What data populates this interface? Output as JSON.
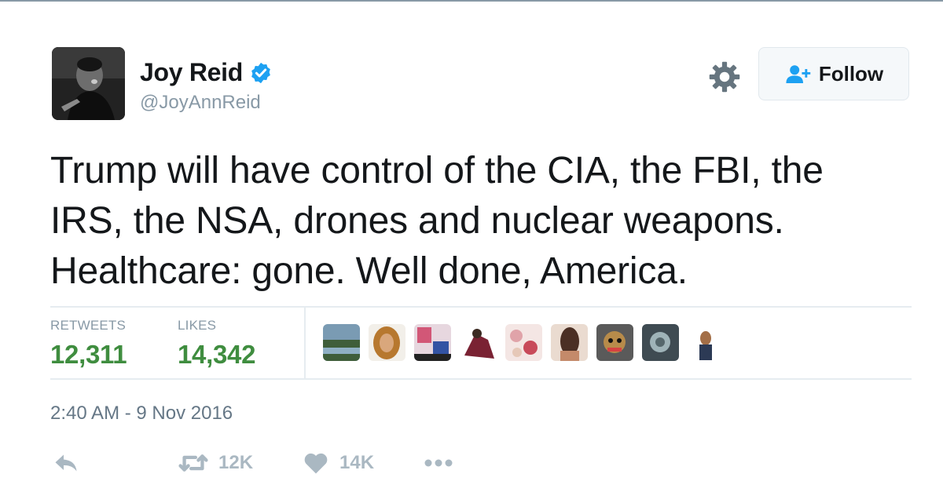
{
  "user": {
    "display_name": "Joy Reid",
    "handle": "@JoyAnnReid",
    "verified": true
  },
  "follow_button": {
    "label": "Follow"
  },
  "tweet": {
    "lines": [
      "Trump will have control of the CIA, the FBI, the",
      "IRS, the NSA, drones and nuclear weapons.",
      "Healthcare: gone. Well done, America."
    ],
    "timestamp": "2:40 AM - 9 Nov 2016"
  },
  "stats": {
    "retweets_label": "RETWEETS",
    "retweets_value": "12,311",
    "likes_label": "LIKES",
    "likes_value": "14,342"
  },
  "actions": {
    "reply_icon": "reply-icon",
    "retweet_icon": "retweet-icon",
    "retweet_count": "12K",
    "like_icon": "heart-icon",
    "like_count": "14K",
    "more_icon": "more-icon"
  },
  "colors": {
    "stat_value": "#3f8d3f",
    "verified": "#1da1f2",
    "follow_icon": "#1da1f2",
    "muted": "#8899a6",
    "action_icon": "#aab8c2"
  }
}
